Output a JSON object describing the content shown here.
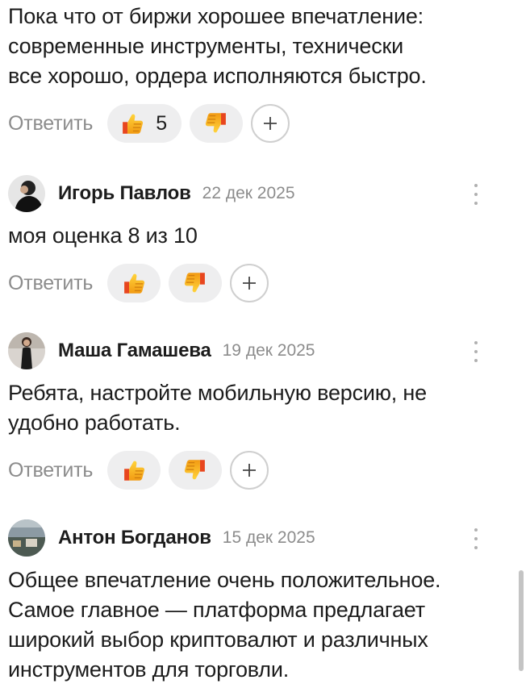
{
  "comments": [
    {
      "text": [
        "Пока что от биржи хорошее впечатление:",
        "современные инструменты, технически",
        "все хорошо, ордера исполняются быстро."
      ],
      "reply_label": "Ответить",
      "like_count": "5"
    },
    {
      "author": "Игорь Павлов",
      "date": "22 дек 2025",
      "text": [
        "моя оценка 8 из 10"
      ],
      "reply_label": "Ответить"
    },
    {
      "author": "Маша Гамашева",
      "date": "19 дек 2025",
      "text": [
        "Ребята, настройте мобильную версию, не",
        "удобно работать."
      ],
      "reply_label": "Ответить"
    },
    {
      "author": "Антон Богданов",
      "date": "15 дек 2025",
      "text": [
        "Общее впечатление очень положительное.",
        "Самое главное — платформа предлагает",
        "широкий выбор криптовалют и различных",
        "инструментов для торговли."
      ]
    }
  ],
  "icons": {
    "like": "thumbs-up-icon",
    "dislike": "thumbs-down-icon",
    "add_reaction": "plus-icon",
    "menu": "more-vertical-icon"
  },
  "colors": {
    "reaction_yellow": "#f7b21b",
    "reaction_red": "#e8461e",
    "muted": "#8c8c8c"
  }
}
